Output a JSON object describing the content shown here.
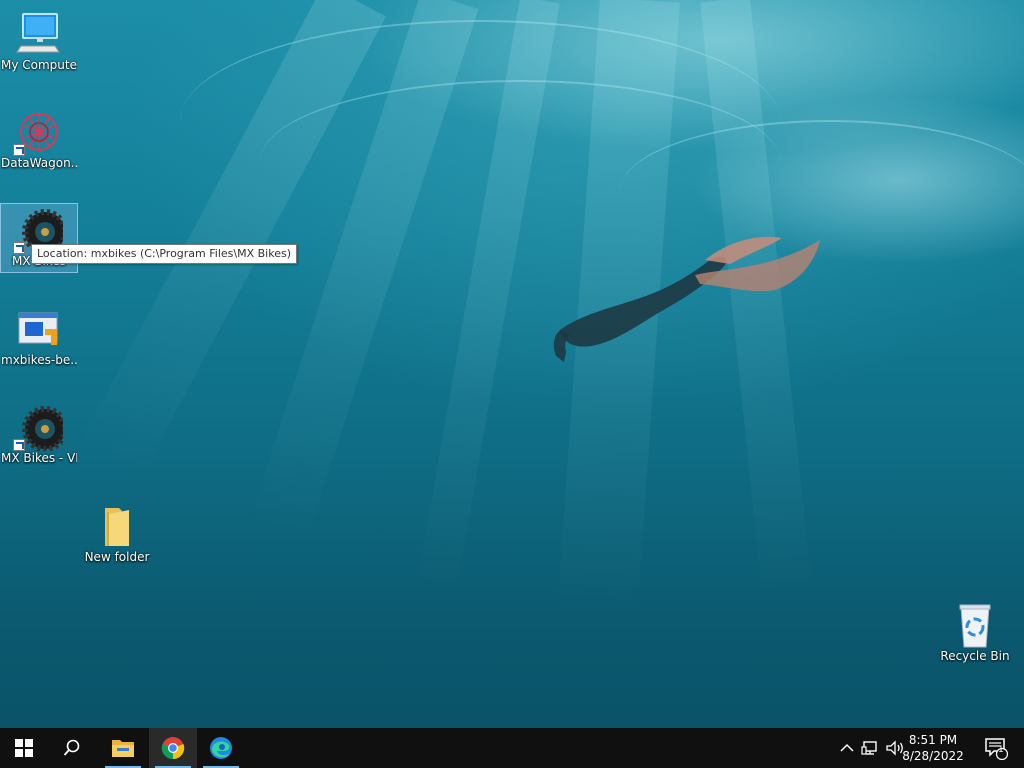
{
  "desktop": {
    "icons": [
      {
        "label": "My Computer"
      },
      {
        "label": "DataWagon..."
      },
      {
        "label": "MX Bikes"
      },
      {
        "label": "mxbikes-be..."
      },
      {
        "label": "MX Bikes - VR"
      },
      {
        "label": "New folder"
      },
      {
        "label": "Recycle Bin"
      }
    ],
    "tooltip": "Location: mxbikes (C:\\Program Files\\MX Bikes)"
  },
  "taskbar": {
    "start_icon": "windows-logo-icon",
    "search_icon": "search-icon",
    "pinned": [
      {
        "name": "file-explorer",
        "icon": "folder-icon"
      },
      {
        "name": "chrome",
        "icon": "chrome-icon",
        "active": true
      },
      {
        "name": "edge",
        "icon": "edge-icon"
      }
    ],
    "tray": {
      "time": "8:51 PM",
      "date": "8/28/2022",
      "notification_count": "1"
    }
  },
  "colors": {
    "taskbar_bg": "#101010",
    "accent": "#76b9ed",
    "water": "#14809a"
  }
}
